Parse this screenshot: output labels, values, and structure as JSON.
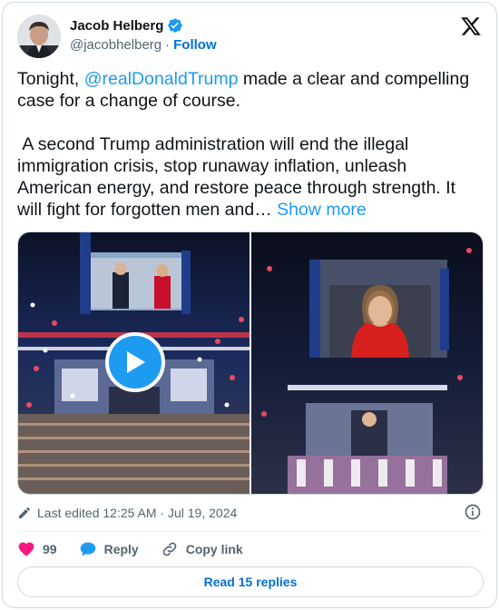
{
  "author": {
    "name": "Jacob Helberg",
    "handle": "@jacobhelberg",
    "follow_label": "Follow"
  },
  "tweet": {
    "text_before": "Tonight, ",
    "mention": "@realDonaldTrump",
    "text_after": " made a clear and compelling case for a change of course.\n\n A second Trump administration will end the illegal immigration crisis, stop runaway inflation, unleash American energy, and restore peace through strength. It will fight for forgotten men and… ",
    "show_more": "Show more"
  },
  "meta": {
    "edited": "Last edited 12:25 AM · Jul 19, 2024"
  },
  "actions": {
    "likes": "99",
    "reply": "Reply",
    "copy_link": "Copy link"
  },
  "replies_button": "Read 15 replies",
  "colors": {
    "accent": "#1d9bf0",
    "link": "#006fd6",
    "like": "#f91880",
    "muted": "#536471"
  },
  "icons": [
    "verified-icon",
    "x-logo-icon",
    "play-icon",
    "pencil-icon",
    "info-icon",
    "heart-icon",
    "reply-bubble-icon",
    "link-icon"
  ]
}
